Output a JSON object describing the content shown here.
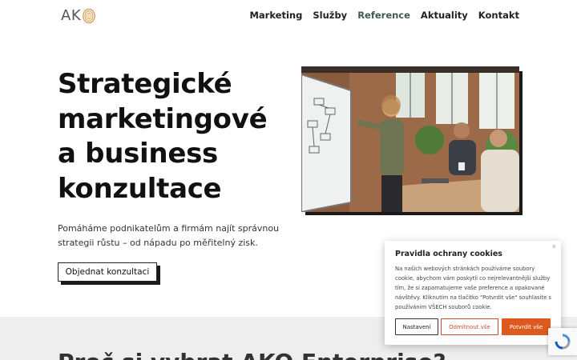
{
  "header": {
    "logo_text": "AK",
    "nav": [
      {
        "label": "Marketing"
      },
      {
        "label": "Služby"
      },
      {
        "label": "Reference"
      },
      {
        "label": "Aktuality"
      },
      {
        "label": "Kontakt"
      }
    ],
    "active_index": 2
  },
  "hero": {
    "title_lines": [
      "Strategické",
      "marketingové",
      "a business",
      "konzultace"
    ],
    "text": "Pomáháme podnikatelům a firmám najít správnou strategii růstu – od nápadu po měřitelný zisk.",
    "cta_label": "Objednat konzultaci"
  },
  "section2": {
    "heading": "Proč si vybrat AKO Enterprise?"
  },
  "cookie_banner": {
    "close_glyph": "×",
    "title": "Pravidla ochrany cookies",
    "text": "Na našich webových stránkách používáme soubory cookie, abychom vám poskytli co nejrelevantnější služby tím, že si zapamatujeme vaše preference a opakované návštěvy. Kliknutím na tlačítko \"Potvrdit vše\" souhlasíte s používáním VŠECH souborů cookie.",
    "settings_label": "Nastavení",
    "reject_label": "Odmítnout vše",
    "accept_label": "Potvrdit vše"
  },
  "colors": {
    "accent_orange": "#dc5a1e",
    "logo_gold": "#d9a05b",
    "grey_band": "#eeeeee"
  },
  "icons": {
    "logo_mark": "fingerprint-o-icon",
    "recaptcha": "recaptcha-icon",
    "close": "close-icon"
  }
}
